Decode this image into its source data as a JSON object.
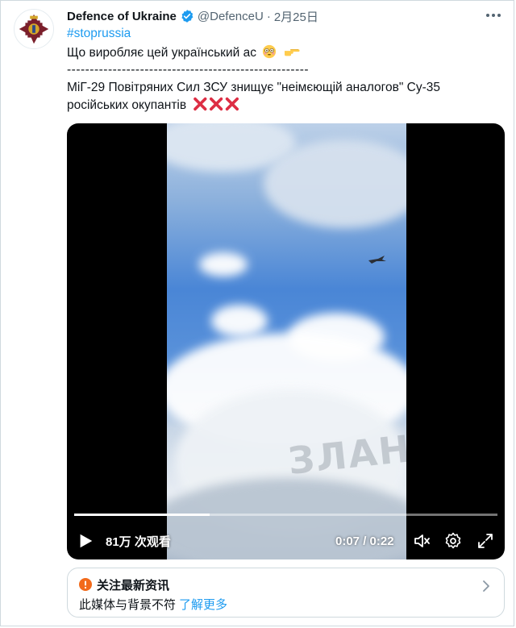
{
  "tweet": {
    "author_name": "Defence of Ukraine",
    "handle": "@DefenceU",
    "separator": "·",
    "date": "2月25日",
    "hashtag": "#stoprussia",
    "line1": "Що виробляє цей український ас",
    "divider": "-----------------------------------------------------",
    "line2": "МіГ-29 Повітряних Сил ЗСУ знищує \"неімєющій аналогов\" Су-35",
    "line3": "російських окупантів",
    "verified_color": "#1d9bf0"
  },
  "video": {
    "views": "81万 次观看",
    "time": "0:07 / 0:22",
    "progress": 0.32,
    "watermark": "ЗЛАНАЛ",
    "icons": {
      "play": "play-icon",
      "volume": "volume-icon",
      "settings": "settings-icon",
      "fullscreen": "fullscreen-icon"
    }
  },
  "notice": {
    "title": "关注最新资讯",
    "body": "此媒体与背景不符",
    "link": "了解更多",
    "accent": "#f26a1b"
  }
}
